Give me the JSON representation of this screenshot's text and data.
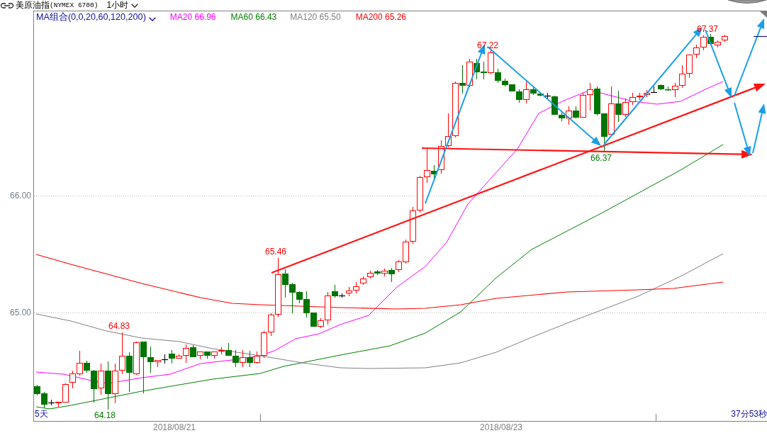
{
  "header": {
    "title": "美原油指",
    "symbol": "(NYMEX 6700)",
    "interval": "1小时"
  },
  "chart": {
    "indicator": "MA组合(0,0,20,60,120,200)",
    "moving_averages": [
      {
        "label": "MA20 66.96",
        "color": "#ff00ff"
      },
      {
        "label": "MA60 66.43",
        "color": "#008000"
      },
      {
        "label": "MA120 65.50",
        "color": "#808080"
      },
      {
        "label": "MA200 65.26",
        "color": "#ff0000"
      }
    ],
    "y_axis": [
      "66.00",
      "65.00"
    ],
    "x_axis": [
      "2018/08/21",
      "2018/08/23"
    ],
    "price_labels": [
      {
        "text": "67.22",
        "kind": "high"
      },
      {
        "text": "67.37",
        "kind": "high"
      },
      {
        "text": "66.37",
        "kind": "low"
      },
      {
        "text": "65.46",
        "kind": "high"
      },
      {
        "text": "64.83",
        "kind": "high"
      },
      {
        "text": "64.18",
        "kind": "low"
      }
    ],
    "range": "5天",
    "countdown": "37分53秒"
  }
}
